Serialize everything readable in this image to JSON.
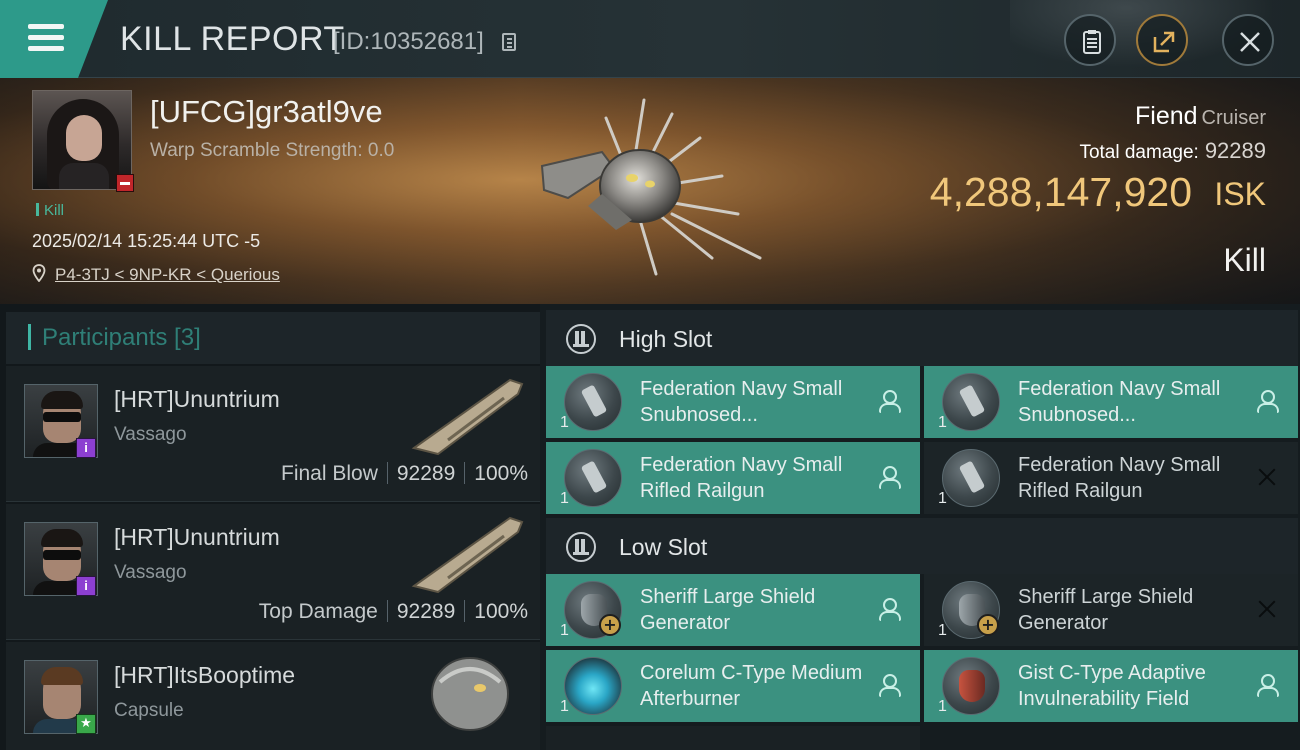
{
  "header": {
    "title": "KILL REPORT",
    "report_id": "[ID:10352681]"
  },
  "victim": {
    "name": "[UFCG]gr3atl9ve",
    "warp_scramble": "Warp Scramble Strength: 0.0",
    "tag": "Kill",
    "timestamp": "2025/02/14 15:25:44 UTC -5",
    "location": "P4-3TJ < 9NP-KR < Querious",
    "ship_name": "Fiend",
    "ship_class": "Cruiser",
    "total_damage_label": "Total damage:",
    "total_damage": "92289",
    "isk_value": "4,288,147,920",
    "isk_unit": "ISK",
    "result": "Kill"
  },
  "participants": {
    "title": "Participants [3]",
    "items": [
      {
        "name": "[HRT]Ununtrium",
        "ship": "Vassago",
        "role": "Final Blow",
        "damage": "92289",
        "percent": "100%",
        "badge": "i"
      },
      {
        "name": "[HRT]Ununtrium",
        "ship": "Vassago",
        "role": "Top Damage",
        "damage": "92289",
        "percent": "100%",
        "badge": "i"
      },
      {
        "name": "[HRT]ItsBooptime",
        "ship": "Capsule",
        "role": "",
        "damage": "",
        "percent": "",
        "badge": "★"
      }
    ]
  },
  "fitting": {
    "high_slot": {
      "title": "High Slot",
      "modules": [
        {
          "name": "Federation Navy Small Snubnosed...",
          "qty": "1",
          "status": "pilot"
        },
        {
          "name": "Federation Navy Small Snubnosed...",
          "qty": "1",
          "status": "pilot"
        },
        {
          "name": "Federation Navy Small Rifled Railgun",
          "qty": "1",
          "status": "pilot"
        },
        {
          "name": "Federation Navy Small Rifled Railgun",
          "qty": "1",
          "status": "destroyed"
        }
      ]
    },
    "low_slot": {
      "title": "Low Slot",
      "modules": [
        {
          "name": "Sheriff Large Shield Generator",
          "qty": "1",
          "status": "pilot"
        },
        {
          "name": "Sheriff Large Shield Generator",
          "qty": "1",
          "status": "destroyed"
        },
        {
          "name": "Corelum C-Type Medium Afterburner",
          "qty": "1",
          "status": "pilot"
        },
        {
          "name": "Gist C-Type Adaptive Invulnerability Field",
          "qty": "1",
          "status": "pilot"
        }
      ]
    }
  },
  "colors": {
    "accent": "#3b9180",
    "isk": "#f0c77b",
    "kill_tag": "#48b89c",
    "badge_minus": "#c0262a",
    "badge_i": "#8c3fd1",
    "badge_star": "#39a84a"
  },
  "icons": [
    "menu-icon",
    "copy-icon",
    "clipboard-icon",
    "share-icon",
    "close-icon",
    "location-pin-icon",
    "high-slot-icon",
    "low-slot-icon",
    "pilot-icon",
    "destroyed-x-icon"
  ]
}
